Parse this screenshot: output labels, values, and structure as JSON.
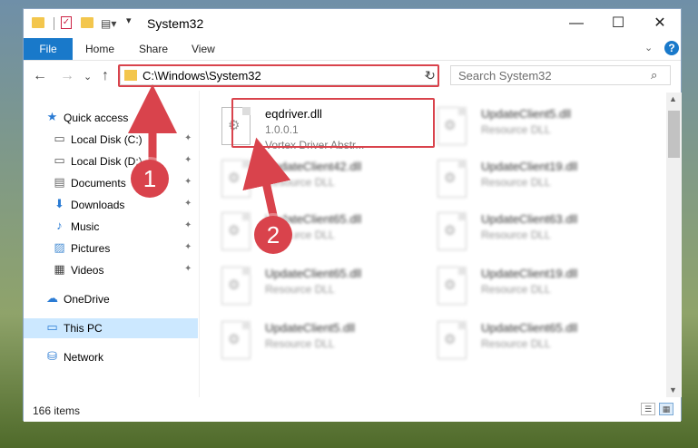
{
  "window": {
    "title": "System32"
  },
  "window_controls": {
    "minimize": "—",
    "maximize": "☐",
    "close": "✕"
  },
  "ribbon": {
    "file": "File",
    "tabs": [
      "Home",
      "Share",
      "View"
    ],
    "expand": "⌄",
    "help": "?"
  },
  "nav": {
    "back": "←",
    "forward": "→",
    "recent": "⌄",
    "up": "↑",
    "address": "C:\\Windows\\System32",
    "address_dropdown": "⌄",
    "refresh": "↻",
    "search_placeholder": "Search System32",
    "search_icon": "⌕"
  },
  "sidebar": {
    "items": [
      {
        "label": "Quick access",
        "icon": "star-icon",
        "glyph": "★",
        "color": "#2a7bd4",
        "pinned": false
      },
      {
        "label": "Local Disk (C:)",
        "icon": "drive-icon",
        "glyph": "▭",
        "color": "#555555",
        "pinned": true
      },
      {
        "label": "Local Disk (D:)",
        "icon": "drive-icon",
        "glyph": "▭",
        "color": "#555555",
        "pinned": true
      },
      {
        "label": "Documents",
        "icon": "documents-icon",
        "glyph": "▤",
        "color": "#6a6a6a",
        "pinned": true
      },
      {
        "label": "Downloads",
        "icon": "download-icon",
        "glyph": "⬇",
        "color": "#2a7bd4",
        "pinned": true
      },
      {
        "label": "Music",
        "icon": "music-icon",
        "glyph": "♪",
        "color": "#2a7bd4",
        "pinned": true
      },
      {
        "label": "Pictures",
        "icon": "pictures-icon",
        "glyph": "▨",
        "color": "#4a8fd4",
        "pinned": true
      },
      {
        "label": "Videos",
        "icon": "video-icon",
        "glyph": "▦",
        "color": "#444444",
        "pinned": true
      },
      {
        "label": "OneDrive",
        "icon": "cloud-icon",
        "glyph": "☁",
        "color": "#2a7bd4",
        "pinned": false
      },
      {
        "label": "This PC",
        "icon": "computer-icon",
        "glyph": "▭",
        "color": "#2a7bd4",
        "pinned": false
      },
      {
        "label": "Network",
        "icon": "network-icon",
        "glyph": "⛁",
        "color": "#2a7bd4",
        "pinned": false
      }
    ],
    "pin_glyph": "📌"
  },
  "files": [
    {
      "name": "eqdriver.dll",
      "line2": "1.0.0.1",
      "line3": "Vortex Driver Abstr...",
      "blurred": false
    },
    {
      "name": "UpdateClient5.dll",
      "line2": "Resource DLL",
      "blurred": true
    },
    {
      "name": "UpdateClient42.dll",
      "line2": "Resource DLL",
      "blurred": true
    },
    {
      "name": "UpdateClient19.dll",
      "line2": "Resource DLL",
      "blurred": true
    },
    {
      "name": "UpdateClient65.dll",
      "line2": "Resource DLL",
      "blurred": true
    },
    {
      "name": "UpdateClient63.dll",
      "line2": "Resource DLL",
      "blurred": true
    },
    {
      "name": "UpdateClient65.dll",
      "line2": "Resource DLL",
      "blurred": true
    },
    {
      "name": "UpdateClient19.dll",
      "line2": "Resource DLL",
      "blurred": true
    },
    {
      "name": "UpdateClient5.dll",
      "line2": "Resource DLL",
      "blurred": true
    },
    {
      "name": "UpdateClient65.dll",
      "line2": "Resource DLL",
      "blurred": true
    }
  ],
  "status": {
    "count": "166 items"
  },
  "annotations": {
    "step1": "1",
    "step2": "2",
    "color": "#d9434c"
  }
}
